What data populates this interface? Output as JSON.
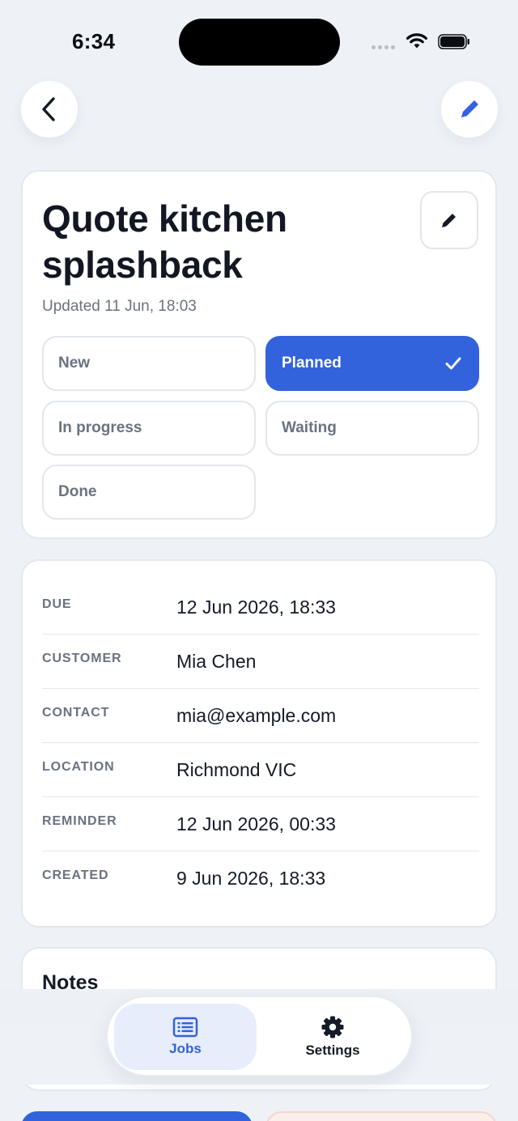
{
  "status_bar": {
    "time": "6:34"
  },
  "job": {
    "title": "Quote kitchen splashback",
    "updated": "Updated 11 Jun, 18:03"
  },
  "statuses": [
    {
      "label": "New",
      "selected": false
    },
    {
      "label": "Planned",
      "selected": true
    },
    {
      "label": "In progress",
      "selected": false
    },
    {
      "label": "Waiting",
      "selected": false
    },
    {
      "label": "Done",
      "selected": false
    }
  ],
  "details": [
    {
      "label": "DUE",
      "value": "12 Jun 2026, 18:33"
    },
    {
      "label": "CUSTOMER",
      "value": "Mia Chen"
    },
    {
      "label": "CONTACT",
      "value": "mia@example.com"
    },
    {
      "label": "LOCATION",
      "value": "Richmond VIC"
    },
    {
      "label": "REMINDER",
      "value": "12 Jun 2026, 00:33"
    },
    {
      "label": "CREATED",
      "value": "9 Jun 2026, 18:33"
    }
  ],
  "notes": {
    "title": "Notes"
  },
  "tabbar": {
    "jobs_label": "Jobs",
    "settings_label": "Settings"
  },
  "colors": {
    "accent": "#3262dc",
    "background": "#eef2f7",
    "muted_text": "#6b7280"
  },
  "icons": {
    "back": "chevron-left-icon",
    "edit": "pencil-icon",
    "selected": "checkmark-icon",
    "jobs": "list-icon",
    "settings": "gear-icon"
  }
}
